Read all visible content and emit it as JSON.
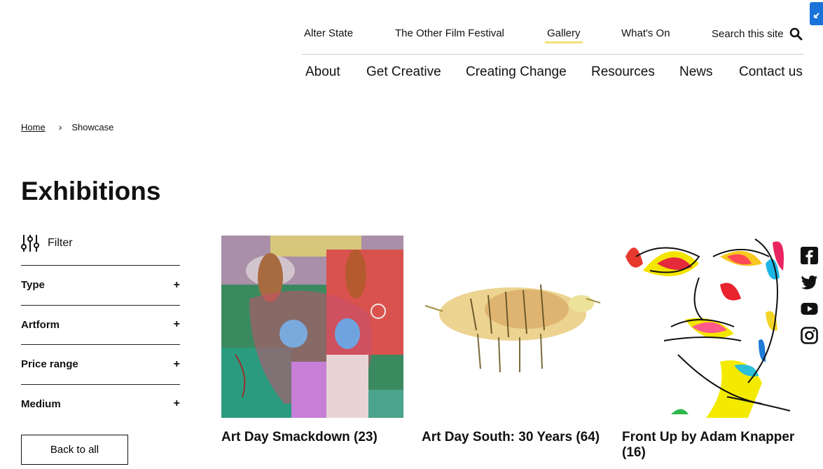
{
  "utility_nav": [
    "Alter State",
    "The Other Film Festival",
    "Gallery",
    "What's On"
  ],
  "search": {
    "label": "Search this site",
    "icon": "search-icon"
  },
  "main_nav": [
    "About",
    "Get Creative",
    "Creating Change",
    "Resources",
    "News",
    "Contact us"
  ],
  "breadcrumb": {
    "home": "Home",
    "current": "Showcase"
  },
  "page_title": "Exhibitions",
  "filter": {
    "label": "Filter",
    "icon": "sliders-icon",
    "groups": [
      "Type",
      "Artform",
      "Price range",
      "Medium"
    ],
    "expand_symbol": "+"
  },
  "back_button": "Back to all",
  "exhibitions": [
    {
      "title": "Art Day Smackdown (23)"
    },
    {
      "title": "Art Day South: 30 Years (64)"
    },
    {
      "title": "Front Up by Adam Knapper (16)"
    }
  ],
  "social": [
    "facebook-icon",
    "twitter-icon",
    "youtube-icon",
    "instagram-icon"
  ],
  "colors": {
    "active_underline": "#f2e07a",
    "corner_tab": "#1a73d9"
  }
}
